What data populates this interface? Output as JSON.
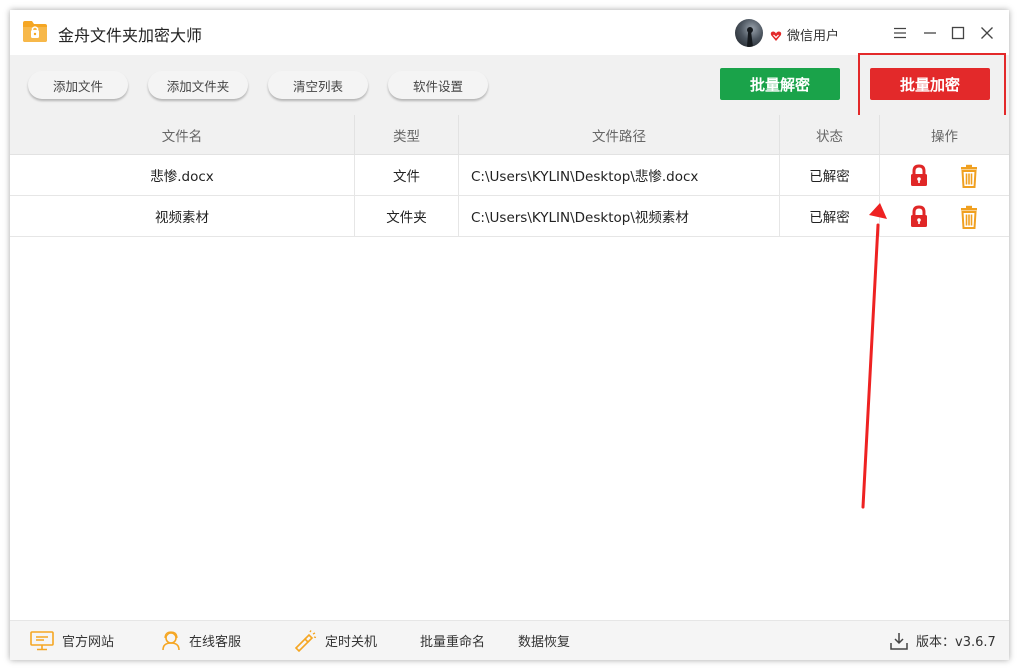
{
  "app": {
    "title": "金舟文件夹加密大师",
    "user_name": "微信用户"
  },
  "toolbar": {
    "add_file": "添加文件",
    "add_folder": "添加文件夹",
    "clear_list": "清空列表",
    "settings": "软件设置",
    "batch_decrypt": "批量解密",
    "batch_encrypt": "批量加密"
  },
  "table": {
    "headers": {
      "name": "文件名",
      "type": "类型",
      "path": "文件路径",
      "status": "状态",
      "actions": "操作"
    },
    "rows": [
      {
        "name": "悲惨.docx",
        "type": "文件",
        "path": "C:\\Users\\KYLIN\\Desktop\\悲惨.docx",
        "status": "已解密"
      },
      {
        "name": "视频素材",
        "type": "文件夹",
        "path": "C:\\Users\\KYLIN\\Desktop\\视频素材",
        "status": "已解密"
      }
    ]
  },
  "footer": {
    "website": "官方网站",
    "support": "在线客服",
    "shutdown": "定时关机",
    "rename": "批量重命名",
    "recovery": "数据恢复",
    "version": "版本：v3.6.7"
  },
  "colors": {
    "decrypt_green": "#1aa34a",
    "encrypt_red": "#e3292a",
    "lock_red": "#e02727",
    "trash_orange": "#f0a020",
    "accent_orange": "#f5a623"
  },
  "icons": {
    "logo": "folder-lock-icon",
    "vip": "vip-heart-icon",
    "menu": "menu-icon",
    "minimize": "minimize-icon",
    "maximize": "maximize-icon",
    "close": "close-icon",
    "lock": "lock-icon",
    "trash": "trash-icon",
    "website": "monitor-icon",
    "support": "headset-user-icon",
    "shutdown": "flashlight-icon",
    "version": "download-icon"
  }
}
